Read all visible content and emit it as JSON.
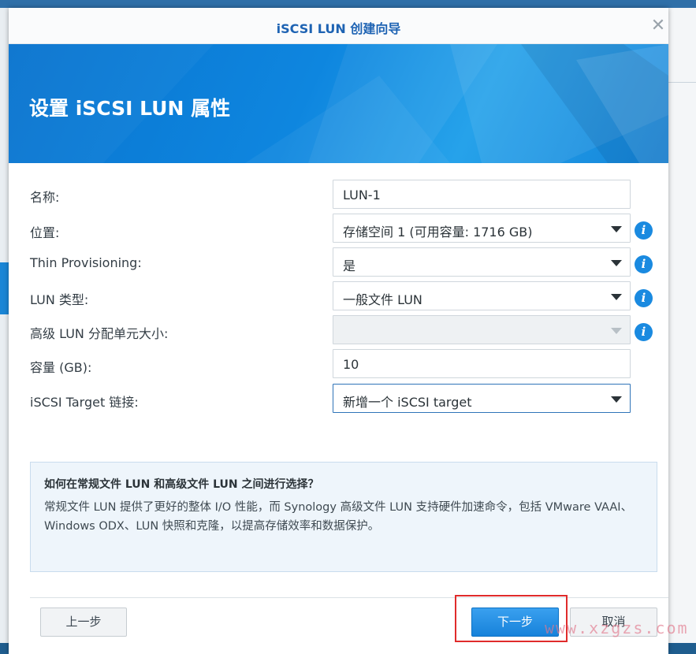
{
  "window": {
    "title": "iSCSI LUN 创建向导",
    "close_icon": "close-icon",
    "close_glyph": "✕"
  },
  "banner": {
    "heading": "设置 iSCSI LUN 属性"
  },
  "form": {
    "name": {
      "label": "名称:",
      "value": "LUN-1"
    },
    "location": {
      "label": "位置:",
      "value": "存储空间 1 (可用容量: 1716 GB)"
    },
    "thin_provisioning": {
      "label": "Thin Provisioning:",
      "value": "是"
    },
    "lun_type": {
      "label": "LUN 类型:",
      "value": "一般文件 LUN"
    },
    "allocation_unit": {
      "label": "高级 LUN 分配单元大小:",
      "value": ""
    },
    "capacity": {
      "label": "容量 (GB):",
      "value": "10"
    },
    "target_link": {
      "label": "iSCSI Target 链接:",
      "value": "新增一个 iSCSI target"
    },
    "info_glyph": "i"
  },
  "help": {
    "title": "如何在常规文件 LUN 和高级文件 LUN 之间进行选择？",
    "body": "常规文件 LUN 提供了更好的整体 I/O 性能，而 Synology 高级文件 LUN 支持硬件加速命令，包括 VMware VAAI、Windows ODX、LUN 快照和克隆，以提高存储效率和数据保护。"
  },
  "footer": {
    "prev_label": "上一步",
    "next_label": "下一步",
    "cancel_label": "取消"
  },
  "watermark": "www.xzgzs.com",
  "colors": {
    "title": "#1e63b3",
    "banner": "#0e86df",
    "primary_button": "#1682da",
    "highlight": "#e02b2b"
  }
}
